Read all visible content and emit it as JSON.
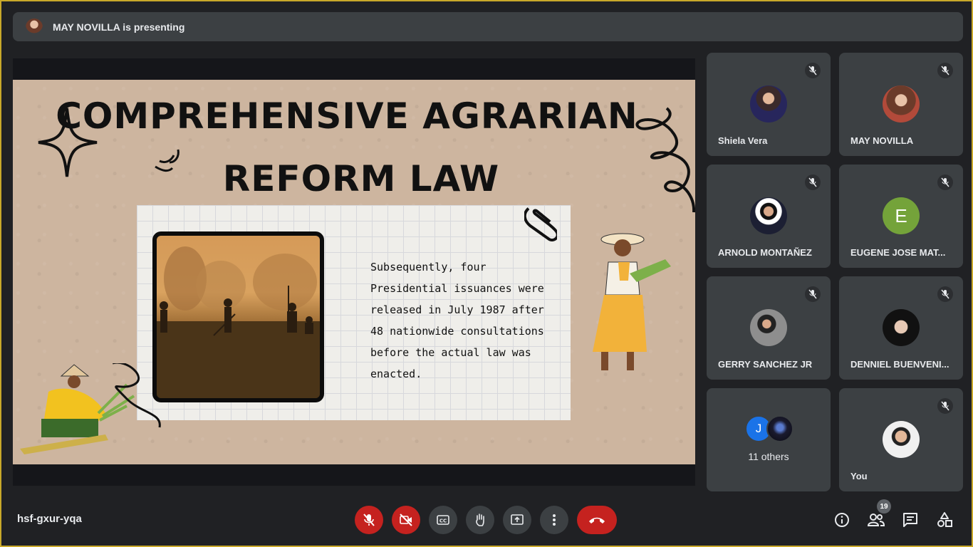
{
  "banner": {
    "text": "MAY NOVILLA is presenting"
  },
  "slide": {
    "title_line1": "COMPREHENSIVE AGRARIAN",
    "title_line2": "REFORM LAW",
    "body": "Subsequently, four Presidential issuances were released in July 1987 after 48 nationwide consultations before the actual law was enacted."
  },
  "participants": [
    {
      "name": "Shiela Vera",
      "avatar": "photo",
      "muted": true
    },
    {
      "name": "MAY NOVILLA",
      "avatar": "photo",
      "muted": true
    },
    {
      "name": "ARNOLD MONTAÑEZ",
      "avatar": "photo",
      "muted": true
    },
    {
      "name": "EUGENE JOSE MAT...",
      "avatar_letter": "E",
      "avatar_color": "#74a33a",
      "muted": true
    },
    {
      "name": "GERRY SANCHEZ JR",
      "avatar": "photo",
      "muted": true
    },
    {
      "name": "DENNIEL BUENVENI...",
      "avatar": "photo",
      "muted": true
    },
    {
      "name": "You",
      "avatar": "photo",
      "muted": true
    }
  ],
  "others": {
    "label": "11 others",
    "letter": "J"
  },
  "toolbar": {
    "meeting_code": "hsf-gxur-yqa",
    "people_count": "19",
    "accent_red": "#c5221f"
  },
  "icons": [
    "mic-off-icon",
    "camera-off-icon",
    "captions-icon",
    "raise-hand-icon",
    "present-icon",
    "more-icon",
    "end-call-icon",
    "info-icon",
    "people-icon",
    "chat-icon",
    "activities-icon"
  ]
}
